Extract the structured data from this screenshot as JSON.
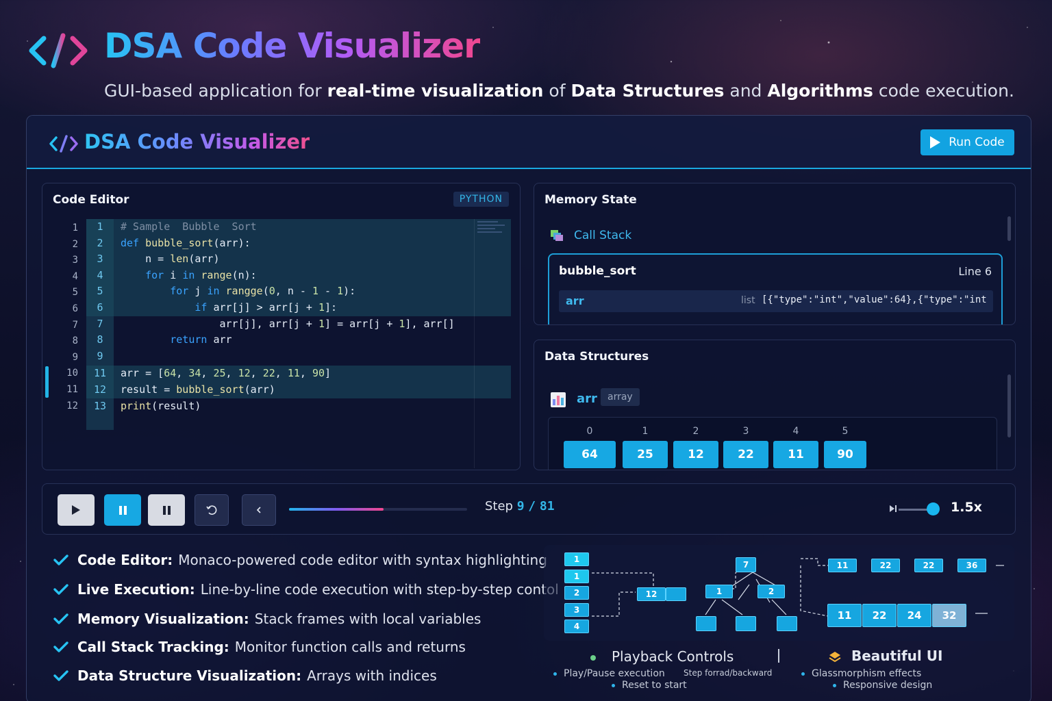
{
  "hero": {
    "title": "DSA Code Visualizer",
    "subtitle_parts": [
      "GUI-based application for ",
      "real-time visualization",
      " of ",
      "Data Structures",
      " and ",
      "Algorithms",
      " code execution."
    ]
  },
  "app": {
    "title": "DSA Code Visualizer",
    "run_label": "Run Code"
  },
  "editor": {
    "title": "Code Editor",
    "language": "PYTHON",
    "outer_line_numbers": [
      "1",
      "2",
      "3",
      "4",
      "5",
      "6",
      "7",
      "8",
      "9",
      "10",
      "11",
      "12"
    ],
    "lines": [
      {
        "n": "1",
        "text": "# Sample  Bubble  Sort"
      },
      {
        "n": "2",
        "text": "def bubble_sort(arr):"
      },
      {
        "n": "3",
        "text": "    n = len(arr)"
      },
      {
        "n": "4",
        "text": "    for i in range(n):"
      },
      {
        "n": "5",
        "text": "        for j in rangge(0, n - 1 - 1):"
      },
      {
        "n": "6",
        "text": "            if arr[j] > arr[j + 1]:"
      },
      {
        "n": "7",
        "text": "                arr[j], arr[j + 1] = arr[j + 1], arr[]"
      },
      {
        "n": "8",
        "text": "        return arr"
      },
      {
        "n": "9",
        "text": ""
      },
      {
        "n": "11",
        "text": "arr = [64, 34, 25, 12, 22, 11, 90]"
      },
      {
        "n": "12",
        "text": "result = bubble_sort(arr)"
      },
      {
        "n": "13",
        "text": "print(result)"
      }
    ]
  },
  "memory": {
    "title": "Memory State",
    "call_stack_label": "Call Stack",
    "frame": {
      "name": "bubble_sort",
      "line": "Line 6",
      "vars": [
        {
          "name": "arr",
          "type": "list",
          "value": "[{\"type\":\"int\",\"value\":64},{\"type\":\"int"
        }
      ]
    }
  },
  "data_structures": {
    "title": "Data Structures",
    "name": "arr",
    "type": "array",
    "indices": [
      "0",
      "1",
      "2",
      "3",
      "4",
      "5"
    ],
    "values": [
      "64",
      "25",
      "12",
      "22",
      "11",
      "90"
    ]
  },
  "playback": {
    "step_label": "Step",
    "step_current": "9",
    "step_total": "81",
    "step_separator": "/",
    "progress_fraction": 0.53,
    "speed": "1.5x",
    "speed_fraction": 0.82
  },
  "features": [
    {
      "key": "Code Editor:",
      "desc": "Monaco-powered code editor with syntax highlighting"
    },
    {
      "key": "Live Execution:",
      "desc": "Line-by-line code execution with step-by-step contol"
    },
    {
      "key": "Memory Visualization:",
      "desc": "Stack frames with local variables"
    },
    {
      "key": "Call Stack Tracking:",
      "desc": "Monitor function calls and returns"
    },
    {
      "key": "Data Structure Visualization:",
      "desc": "Arrays with   indices"
    }
  ],
  "diagram": {
    "stack_values": [
      "1",
      "1",
      "2",
      "3",
      "4"
    ],
    "pointer_value": "12",
    "tree_values": [
      "7",
      "1",
      "2"
    ],
    "list_top": [
      "11",
      "22",
      "22",
      "36"
    ],
    "list_bottom": [
      "11",
      "22",
      "24",
      "32"
    ]
  },
  "captions": {
    "playback_title": "Playback Controls",
    "playback_items": [
      "Play/Pause execution",
      "Step forrad/backward",
      "Reset to start"
    ],
    "ui_title": "Beautiful UI",
    "ui_items": [
      "Glassmorphism effects",
      "Responsive design"
    ]
  },
  "colors": {
    "accent": "#17a8e3",
    "gradient": [
      "#27c3f3",
      "#b35cf5",
      "#f0478f"
    ]
  }
}
